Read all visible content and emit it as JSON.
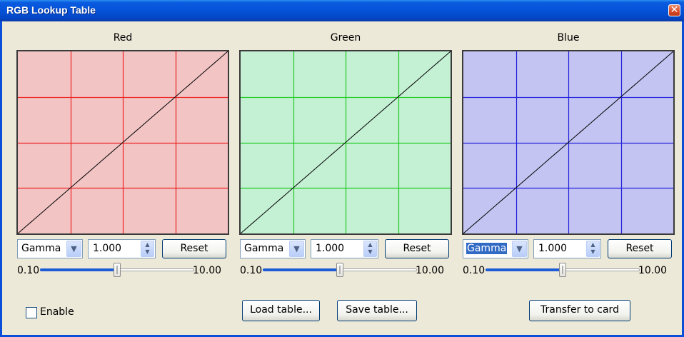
{
  "window": {
    "title": "RGB Lookup Table",
    "close_label": "✕"
  },
  "panels": [
    {
      "key": "red",
      "title": "Red",
      "bg_color": "#f2c4c4",
      "grid_color": "#ee2222",
      "mode": "Gamma",
      "mode_highlighted": false,
      "value": "1.000",
      "reset_label": "Reset",
      "slider_min": "0.10",
      "slider_max": "10.00",
      "slider_position": 0.5
    },
    {
      "key": "green",
      "title": "Green",
      "bg_color": "#c4f0d4",
      "grid_color": "#22cc22",
      "mode": "Gamma",
      "mode_highlighted": false,
      "value": "1.000",
      "reset_label": "Reset",
      "slider_min": "0.10",
      "slider_max": "10.00",
      "slider_position": 0.5
    },
    {
      "key": "blue",
      "title": "Blue",
      "bg_color": "#c4c4f2",
      "grid_color": "#2222dd",
      "mode": "Gamma",
      "mode_highlighted": true,
      "value": "1.000",
      "reset_label": "Reset",
      "slider_min": "0.10",
      "slider_max": "10.00",
      "slider_position": 0.5
    }
  ],
  "icons": {
    "close": "close-icon",
    "dropdown": "chevron-down-icon",
    "spinner": "spinner-arrows-icon"
  },
  "footer": {
    "enable_label": "Enable",
    "enable_checked": false,
    "load_label": "Load table...",
    "save_label": "Save table...",
    "transfer_label": "Transfer to card"
  }
}
